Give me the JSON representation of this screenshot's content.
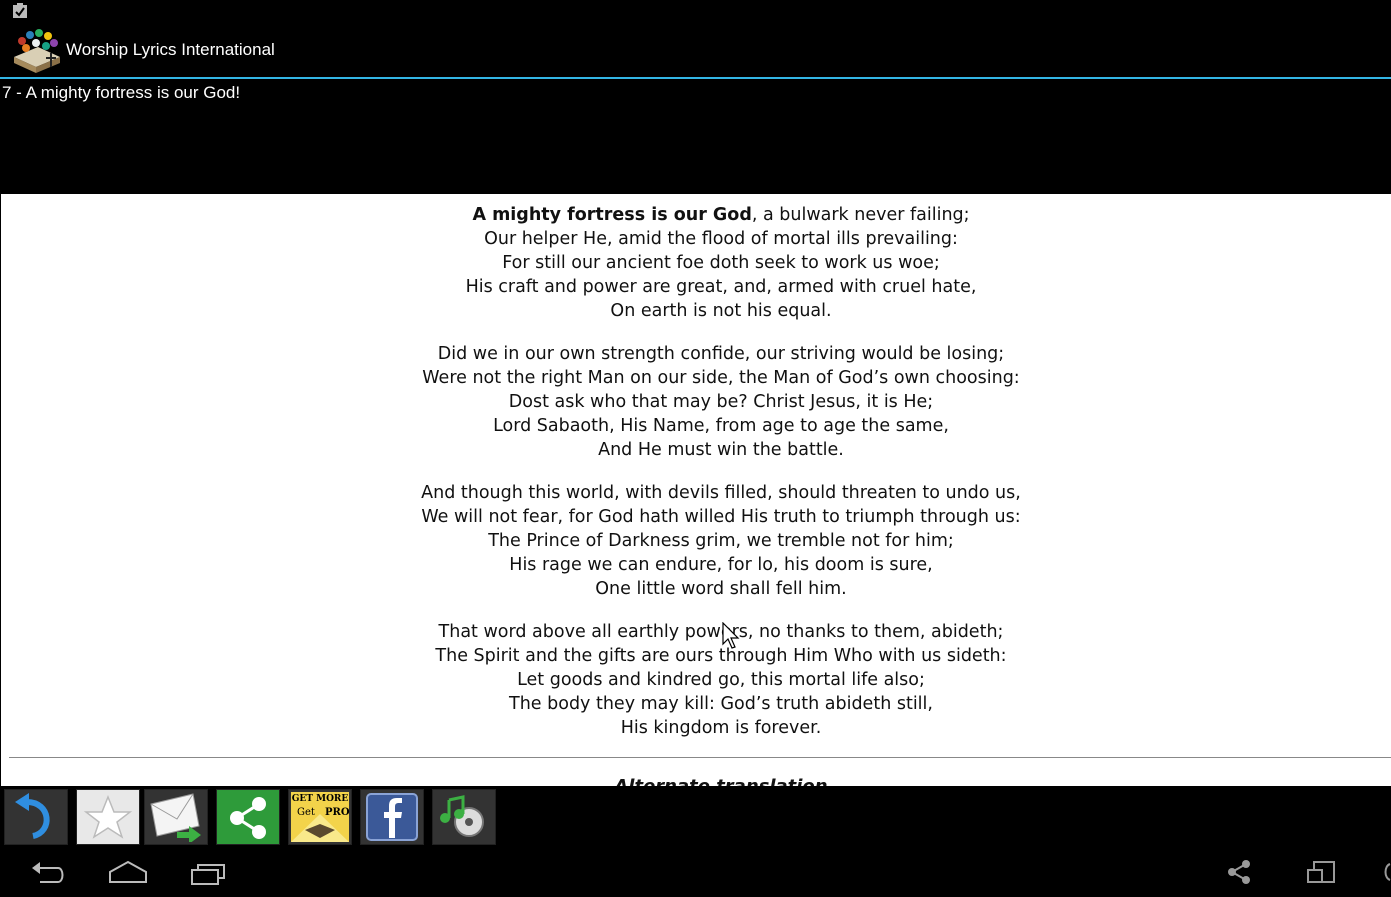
{
  "app": {
    "title": "Worship Lyrics International"
  },
  "song": {
    "title": "7 - A mighty fortress is our God!",
    "first_line_bold": "A mighty fortress is our God",
    "first_line_rest": ", a bulwark never failing;",
    "stanzas": [
      [
        "Our helper He, amid the flood of mortal ills prevailing:",
        "For still our ancient foe doth seek to work us woe;",
        "His craft and power are great, and, armed with cruel hate,",
        "On earth is not his equal."
      ],
      [
        "Did we in our own strength confide, our striving would be losing;",
        "Were not the right Man on our side, the Man of God’s own choosing:",
        "Dost ask who that may be? Christ Jesus, it is He;",
        "Lord Sabaoth, His Name, from age to age the same,",
        "And He must win the battle."
      ],
      [
        "And though this world, with devils filled, should threaten to undo us,",
        "We will not fear, for God hath willed His truth to triumph through us:",
        "The Prince of Darkness grim, we tremble not for him;",
        "His rage we can endure, for lo, his doom is sure,",
        "One little word shall fell him."
      ],
      [
        "That word above all earthly powers, no thanks to them, abideth;",
        "The Spirit and the gifts are ours through Him Who with us sideth:",
        "Let goods and kindred go, this mortal life also;",
        "The body they may kill: God’s truth abideth still,",
        "His kingdom is forever."
      ]
    ],
    "alt_heading": "Alternate translation"
  },
  "toolbar": {
    "pro_line1": "GET MORE",
    "pro_line2": "Get",
    "pro_line3": "PRO"
  },
  "colors": {
    "accent": "#33b5e5",
    "share_green": "#2e9b3a",
    "facebook_blue": "#3b5998"
  }
}
